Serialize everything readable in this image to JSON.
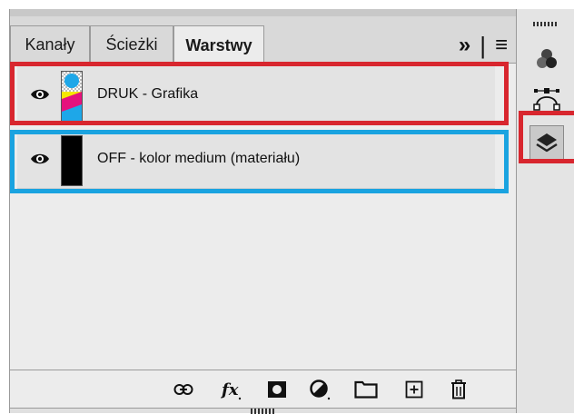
{
  "tabs": [
    {
      "label": "Kanały",
      "active": false
    },
    {
      "label": "Ścieżki",
      "active": false
    },
    {
      "label": "Warstwy",
      "active": true
    }
  ],
  "tabbar": {
    "expand_glyph": "»",
    "separator": "|",
    "menu_glyph": "≡"
  },
  "layers": [
    {
      "name": "DRUK - Grafika",
      "visible": true,
      "thumb": "cmyk-checker",
      "highlight_color": "#d8262e"
    },
    {
      "name": "OFF - kolor medium (materiału)",
      "visible": true,
      "thumb": "black",
      "highlight_color": "#1aa3e0"
    }
  ],
  "bottom_tools": [
    {
      "icon": "link-icon"
    },
    {
      "icon": "fx-icon"
    },
    {
      "icon": "mask-icon"
    },
    {
      "icon": "adjustment-icon"
    },
    {
      "icon": "folder-icon"
    },
    {
      "icon": "new-layer-icon"
    },
    {
      "icon": "trash-icon"
    }
  ],
  "dock": {
    "items": [
      {
        "icon": "channels-icon",
        "active": false
      },
      {
        "icon": "paths-icon",
        "active": false
      },
      {
        "icon": "layers-icon",
        "active": true,
        "highlight_color": "#d8262e"
      }
    ]
  },
  "colors": {
    "highlight_red": "#d8262e",
    "highlight_blue": "#1aa3e0",
    "panel_bg": "#ececec",
    "tab_bg": "#d9d9d9"
  }
}
